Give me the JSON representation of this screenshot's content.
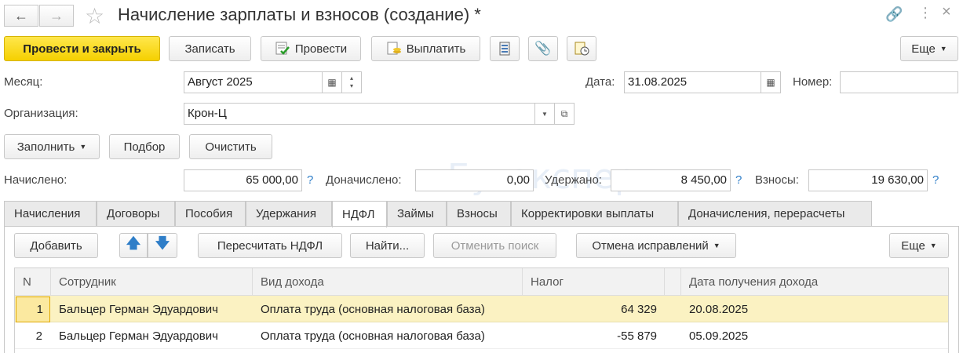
{
  "window": {
    "title": "Начисление зарплаты и взносов (создание) *"
  },
  "toolbar": {
    "post_close": "Провести и закрыть",
    "save": "Записать",
    "post": "Провести",
    "pay": "Выплатить",
    "more": "Еще"
  },
  "form": {
    "month_label": "Месяц:",
    "month_value": "Август 2025",
    "date_label": "Дата:",
    "date_value": "31.08.2025",
    "number_label": "Номер:",
    "number_value": "",
    "org_label": "Организация:",
    "org_value": "Крон-Ц",
    "fill_button": "Заполнить",
    "select_button": "Подбор",
    "clear_button": "Очистить",
    "accrued_label": "Начислено:",
    "accrued_value": "65 000,00",
    "additional_label": "Доначислено:",
    "additional_value": "0,00",
    "withheld_label": "Удержано:",
    "withheld_value": "8 450,00",
    "contrib_label": "Взносы:",
    "contrib_value": "19 630,00",
    "help": "?"
  },
  "watermark": "Бухэксперт",
  "tabs": [
    {
      "label": "Начисления"
    },
    {
      "label": "Договоры"
    },
    {
      "label": "Пособия"
    },
    {
      "label": "Удержания"
    },
    {
      "label": "НДФЛ"
    },
    {
      "label": "Займы"
    },
    {
      "label": "Взносы"
    },
    {
      "label": "Корректировки выплаты"
    },
    {
      "label": "Доначисления, перерасчеты"
    }
  ],
  "ndfl_toolbar": {
    "add": "Добавить",
    "recalc": "Пересчитать НДФЛ",
    "find": "Найти...",
    "cancel_search": "Отменить поиск",
    "cancel_fixes": "Отмена исправлений",
    "more": "Еще"
  },
  "table": {
    "headers": [
      "N",
      "Сотрудник",
      "Вид дохода",
      "Налог",
      "Дата получения дохода"
    ],
    "rows": [
      {
        "n": "1",
        "employee": "Бальцер Герман Эдуардович",
        "income": "Оплата труда (основная налоговая база)",
        "tax": "64 329",
        "date": "20.08.2025"
      },
      {
        "n": "2",
        "employee": "Бальцер Герман Эдуардович",
        "income": "Оплата труда (основная налоговая база)",
        "tax": "-55 879",
        "date": "05.09.2025"
      }
    ]
  },
  "colors": {
    "primary_button": "#f5d000",
    "selected_row": "#fbf2c2",
    "help_icon": "#2f7ec8"
  }
}
